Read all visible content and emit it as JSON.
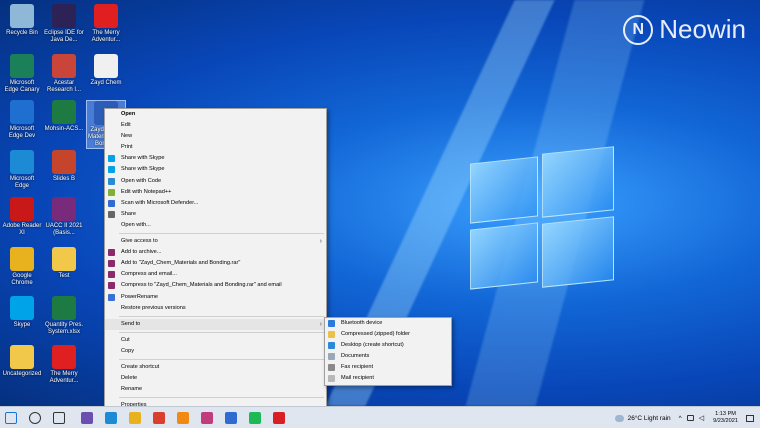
{
  "watermark": {
    "text": "Neowin"
  },
  "desktop_icons": [
    {
      "label": "Recycle Bin",
      "icon": "recycle-bin-icon",
      "color": "#8fb8d8"
    },
    {
      "label": "Eclipse IDE for Java De...",
      "icon": "eclipse-icon",
      "color": "#2c2255"
    },
    {
      "label": "The Merry Adventur...",
      "icon": "pdf-icon",
      "color": "#e02020"
    },
    {
      "label": "Microsoft Edge Canary",
      "icon": "edge-canary-icon",
      "color": "#1b7f5a"
    },
    {
      "label": "Acestar Research I...",
      "icon": "package-icon",
      "color": "#c9453a"
    },
    {
      "label": "Zayd Chem",
      "icon": "blank-file-icon",
      "color": "#f0f0f0"
    },
    {
      "label": "Microsoft Edge Dev",
      "icon": "edge-dev-icon",
      "color": "#1e6fd0"
    },
    {
      "label": "Mohsin-ACS...",
      "icon": "excel-icon",
      "color": "#1d7a43"
    },
    {
      "label": "Zayd Chem Materials and Bonding",
      "icon": "word-icon",
      "color": "#2b5cb8"
    },
    {
      "label": "Microsoft Edge",
      "icon": "edge-icon",
      "color": "#1d8ad6"
    },
    {
      "label": "Slides B",
      "icon": "powerpoint-icon",
      "color": "#c4452c"
    },
    {
      "label": "Adobe Reader XI",
      "icon": "acrobat-icon",
      "color": "#c81818"
    },
    {
      "label": "UACC II 2021 (Basis...",
      "icon": "winrar-icon",
      "color": "#7a2a7a"
    },
    {
      "label": "Google Chrome",
      "icon": "chrome-icon",
      "color": "#e8b21f"
    },
    {
      "label": "Test",
      "icon": "folder-icon",
      "color": "#f2c84b"
    },
    {
      "label": "Skype",
      "icon": "skype-icon",
      "color": "#00a2e8"
    },
    {
      "label": "Quantity Pres. System.xlsx",
      "icon": "excel-icon",
      "color": "#1d7a43"
    },
    {
      "label": "Uncategorized",
      "icon": "folder-icon",
      "color": "#f2c84b"
    },
    {
      "label": "The Merry Adventur...",
      "icon": "pdf-icon",
      "color": "#e02020"
    }
  ],
  "context_menu": {
    "items": [
      {
        "label": "Open",
        "bold": true
      },
      {
        "label": "Edit"
      },
      {
        "label": "New"
      },
      {
        "label": "Print"
      },
      {
        "label": "Share with Skype",
        "icon": "skype-icon",
        "color": "#00a2e8"
      },
      {
        "label": "Share with Skype",
        "icon": "skype-icon",
        "color": "#00a2e8"
      },
      {
        "label": "Open with Code",
        "icon": "vscode-icon",
        "color": "#2a8ad4"
      },
      {
        "label": "Edit with Notepad++",
        "icon": "notepadpp-icon",
        "color": "#7fb03a"
      },
      {
        "label": "Scan with Microsoft Defender...",
        "icon": "defender-icon",
        "color": "#2f6bd0"
      },
      {
        "label": "Share",
        "icon": "share-icon",
        "color": "#666666"
      },
      {
        "label": "Open with..."
      },
      {
        "sep": true
      },
      {
        "label": "Give access to",
        "submenu": true
      },
      {
        "label": "Add to archive...",
        "icon": "winrar-icon",
        "color": "#8a2a6a"
      },
      {
        "label": "Add to \"Zayd_Chem_Materials and Bonding.rar\"",
        "icon": "winrar-icon",
        "color": "#8a2a6a"
      },
      {
        "label": "Compress and email...",
        "icon": "winrar-icon",
        "color": "#8a2a6a"
      },
      {
        "label": "Compress to \"Zayd_Chem_Materials and Bonding.rar\" and email",
        "icon": "winrar-icon",
        "color": "#8a2a6a"
      },
      {
        "label": "PowerRename",
        "icon": "powerrename-icon",
        "color": "#3a6fd8"
      },
      {
        "label": "Restore previous versions"
      },
      {
        "sep": true
      },
      {
        "label": "Send to",
        "submenu": true,
        "hover": true
      },
      {
        "sep": true
      },
      {
        "label": "Cut"
      },
      {
        "label": "Copy"
      },
      {
        "sep": true
      },
      {
        "label": "Create shortcut"
      },
      {
        "label": "Delete"
      },
      {
        "label": "Rename"
      },
      {
        "sep": true
      },
      {
        "label": "Properties"
      }
    ]
  },
  "send_to_menu": {
    "items": [
      {
        "label": "Bluetooth device",
        "icon": "bluetooth-icon",
        "color": "#2a7ae0"
      },
      {
        "label": "Compressed (zipped) folder",
        "icon": "zip-folder-icon",
        "color": "#e8c24a"
      },
      {
        "label": "Desktop (create shortcut)",
        "icon": "desktop-icon",
        "color": "#2a8ad8"
      },
      {
        "label": "Documents",
        "icon": "documents-icon",
        "color": "#9aa8b8"
      },
      {
        "label": "Fax recipient",
        "icon": "fax-icon",
        "color": "#8a8a8a"
      },
      {
        "label": "Mail recipient",
        "icon": "mail-icon",
        "color": "#b8b8b8"
      }
    ]
  },
  "taskbar": {
    "apps": [
      {
        "name": "start-button",
        "color": "#1a73d9"
      },
      {
        "name": "search-icon",
        "color": "#333333"
      },
      {
        "name": "task-view-icon",
        "color": "#333333"
      },
      {
        "name": "eclipse-taskbar-icon",
        "color": "#6a4fb0"
      },
      {
        "name": "edge-taskbar-icon",
        "color": "#1d8ad6"
      },
      {
        "name": "file-explorer-taskbar-icon",
        "color": "#e8b21f"
      },
      {
        "name": "chrome-taskbar-icon",
        "color": "#d93f2f"
      },
      {
        "name": "vlc-taskbar-icon",
        "color": "#f08a12"
      },
      {
        "name": "slack-taskbar-icon",
        "color": "#c23b7d"
      },
      {
        "name": "teams-taskbar-icon",
        "color": "#2f6bd0"
      },
      {
        "name": "spotify-taskbar-icon",
        "color": "#1db954"
      },
      {
        "name": "netflix-taskbar-icon",
        "color": "#d81f26"
      }
    ],
    "weather": "26°C  Light rain",
    "time": "1:13 PM",
    "date": "9/23/2021"
  }
}
